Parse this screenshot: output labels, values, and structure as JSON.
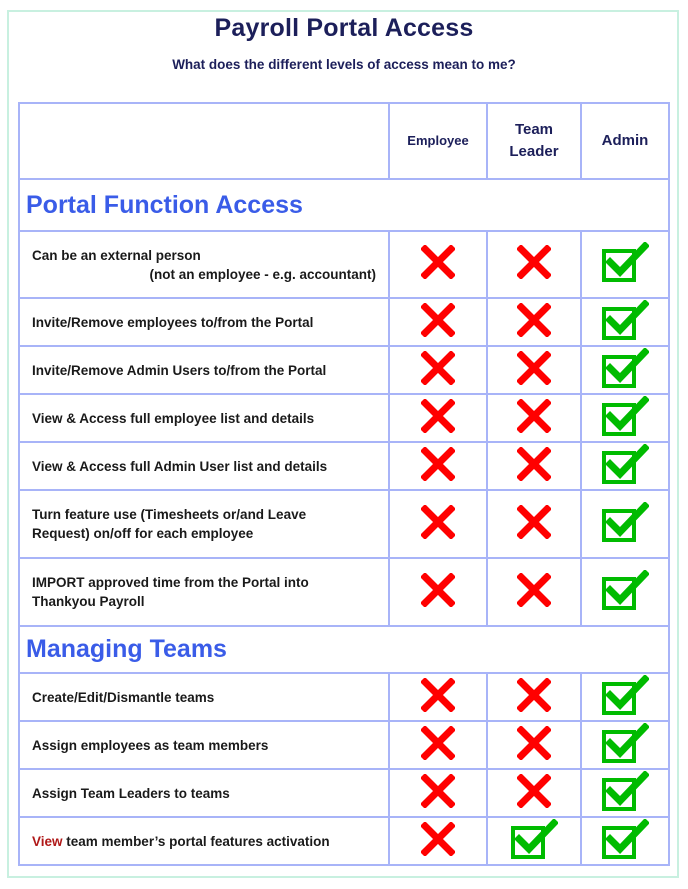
{
  "header": {
    "title": "Payroll Portal Access",
    "subtitle": "What does the different levels of access mean to me?"
  },
  "columns": {
    "label": "",
    "employee": "Employee",
    "team_leader_line1": "Team",
    "team_leader_line2": "Leader",
    "admin": "Admin"
  },
  "colors": {
    "title": "#1c1f5a",
    "section_heading": "#3a5ce8",
    "grid_border": "#a8b4f8",
    "frame_border": "#c8f0e0",
    "deny_icon": "#ff0000",
    "allow_icon": "#00bb00",
    "highlight_word": "#b01818"
  },
  "sections": [
    {
      "heading": "Portal Function Access",
      "rows": [
        {
          "label": "Can be an external person",
          "sublabel": "(not an employee - e.g. accountant)",
          "employee": "deny",
          "team_leader": "deny",
          "admin": "allow"
        },
        {
          "label": "Invite/Remove employees to/from the Portal",
          "employee": "deny",
          "team_leader": "deny",
          "admin": "allow"
        },
        {
          "label": "Invite/Remove Admin Users to/from the Portal",
          "employee": "deny",
          "team_leader": "deny",
          "admin": "allow"
        },
        {
          "label": "View & Access full employee list and details",
          "employee": "deny",
          "team_leader": "deny",
          "admin": "allow"
        },
        {
          "label": "View & Access full Admin User list and details",
          "employee": "deny",
          "team_leader": "deny",
          "admin": "allow"
        },
        {
          "label_line1": "Turn feature use (Timesheets or/and Leave",
          "label_line2": "Request) on/off for each employee",
          "employee": "deny",
          "team_leader": "deny",
          "admin": "allow"
        },
        {
          "label_line1": "IMPORT approved time from the Portal into",
          "label_line2": "Thankyou Payroll",
          "employee": "deny",
          "team_leader": "deny",
          "admin": "allow"
        }
      ]
    },
    {
      "heading": "Managing Teams",
      "rows": [
        {
          "label": "Create/Edit/Dismantle teams",
          "employee": "deny",
          "team_leader": "deny",
          "admin": "allow"
        },
        {
          "label": "Assign employees as team members",
          "employee": "deny",
          "team_leader": "deny",
          "admin": "allow"
        },
        {
          "label": "Assign Team Leaders to teams",
          "employee": "deny",
          "team_leader": "deny",
          "admin": "allow"
        },
        {
          "label_highlight": "View",
          "label_rest": " team member’s portal features activation",
          "employee": "deny",
          "team_leader": "allow",
          "admin": "allow"
        }
      ]
    }
  ],
  "icons": {
    "deny": "red-cross-icon",
    "allow": "green-checkbox-icon"
  }
}
